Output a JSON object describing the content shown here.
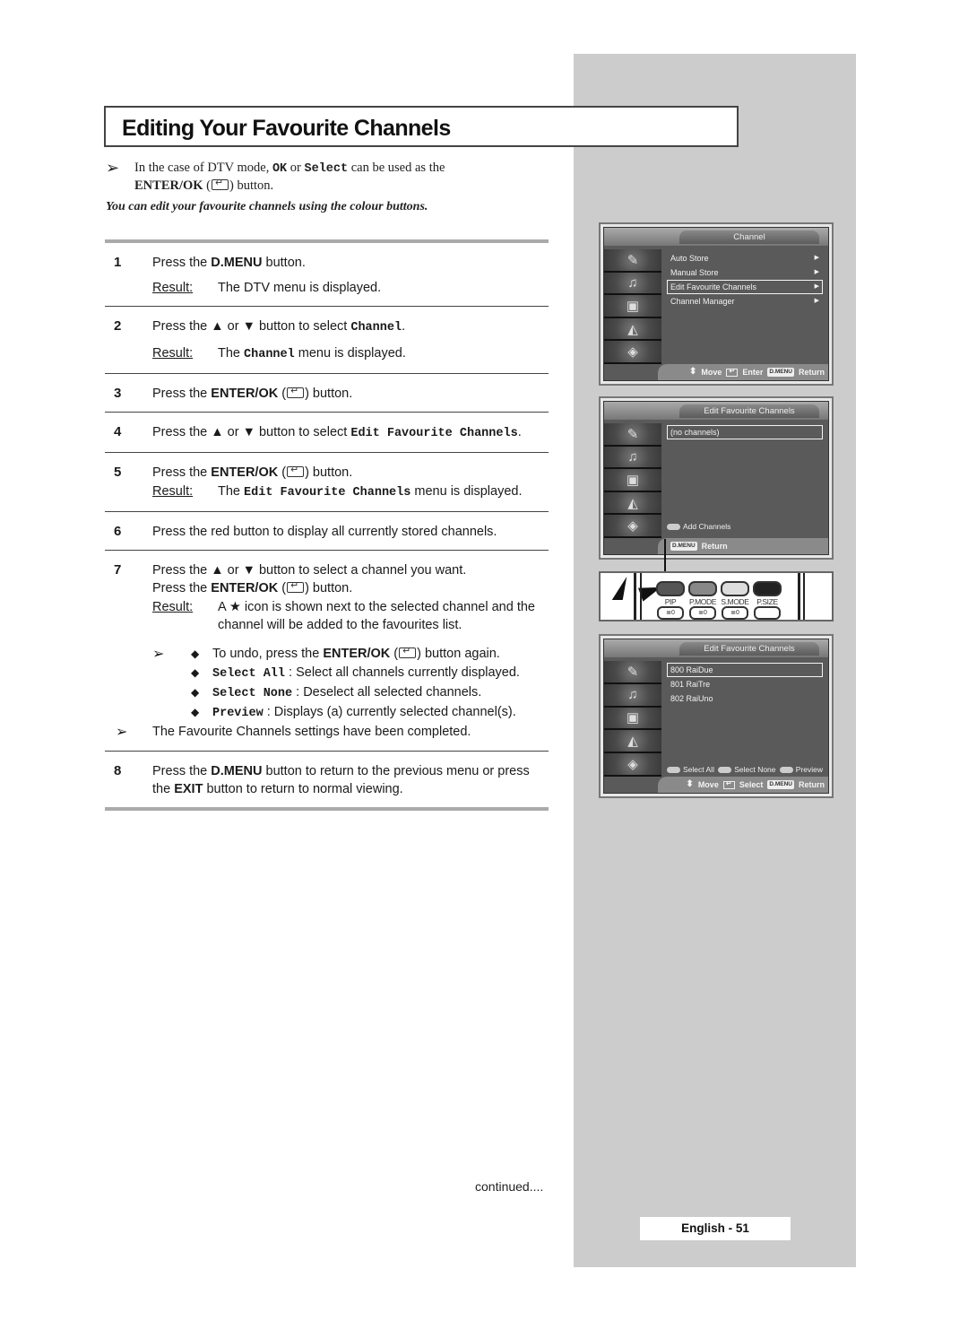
{
  "page": {
    "title": "Editing Your Favourite Channels",
    "note_top": {
      "prefix": "In the case of DTV mode,",
      "ok": "OK",
      "or": "or",
      "select": "Select",
      "suffix": "can be used as the",
      "enter_ok": "ENTER/OK",
      "button_word": "button."
    },
    "intro": "You can edit your favourite channels using the colour buttons.",
    "result_label": "Result:",
    "steps": [
      {
        "num": "1",
        "pre": "Press the",
        "bold": "D.MENU",
        "post": "button.",
        "result": "The DTV menu is displayed."
      },
      {
        "num": "2",
        "pre": "Press the ▲ or ▼ button to select",
        "mono": "Channel",
        "post": ".",
        "result_pre": "The",
        "result_mono": "Channel",
        "result_post": "menu is displayed."
      },
      {
        "num": "3",
        "pre": "Press the",
        "bold": "ENTER/OK",
        "post": "button."
      },
      {
        "num": "4",
        "pre": "Press the ▲ or ▼ button to select",
        "mono": "Edit Favourite Channels",
        "post": "."
      },
      {
        "num": "5",
        "pre": "Press the",
        "bold": "ENTER/OK",
        "post": "button.",
        "result_pre": "The",
        "result_mono": "Edit Favourite Channels",
        "result_post": "menu is displayed."
      },
      {
        "num": "6",
        "text": "Press the red button to display all currently stored channels."
      },
      {
        "num": "7",
        "line1": "Press the ▲ or ▼ button to select a channel you want.",
        "pre": "Press the",
        "bold": "ENTER/OK",
        "post": "button.",
        "result": "A ★ icon is shown next to the selected channel and the channel will be added to the favourites list."
      },
      {
        "num": "8",
        "pre": "Press the",
        "bold": "D.MENU",
        "mid": "button to return to the previous menu or press the",
        "bold2": "EXIT",
        "post": "button to return to normal viewing."
      }
    ],
    "tips": {
      "undo_pre": "To undo, press the",
      "undo_bold": "ENTER/OK",
      "undo_post": "button again.",
      "select_all_key": "Select All",
      "select_all_desc": ": Select all channels currently displayed.",
      "select_none_key": "Select None",
      "select_none_desc": ": Deselect all selected channels.",
      "preview_key": "Preview",
      "preview_desc": ": Displays (a) currently selected channel(s).",
      "completed": "The Favourite Channels settings have been completed."
    },
    "continued": "continued....",
    "page_number": "English - 51"
  },
  "osd1": {
    "title": "Channel",
    "items": [
      {
        "label": "Auto Store",
        "arrow": "▶",
        "selected": false
      },
      {
        "label": "Manual Store",
        "arrow": "▶",
        "selected": false
      },
      {
        "label": "Edit Favourite Channels",
        "arrow": "▶",
        "selected": true
      },
      {
        "label": "Channel Manager",
        "arrow": "▶",
        "selected": false
      }
    ],
    "footer": {
      "move": "Move",
      "enter": "Enter",
      "dmenu": "D.MENU",
      "return": "Return"
    }
  },
  "osd2": {
    "title": "Edit Favourite Channels",
    "items": [
      {
        "label": "(no channels)",
        "selected": true
      }
    ],
    "action": "Add Channels",
    "footer": {
      "dmenu": "D.MENU",
      "return": "Return"
    }
  },
  "remote": {
    "buttons": [
      {
        "label": "PIP",
        "color": "#555555"
      },
      {
        "label": "P.MODE",
        "color": "#888888"
      },
      {
        "label": "S.MODE",
        "color": "#dddddd"
      },
      {
        "label": "P.SIZE",
        "color": "#222222"
      }
    ],
    "sub_icon": "≣0"
  },
  "osd3": {
    "title": "Edit Favourite Channels",
    "items": [
      {
        "label": "800 RaiDue",
        "selected": true
      },
      {
        "label": "801 RaiTre",
        "selected": false
      },
      {
        "label": "802 RaiUno",
        "selected": false
      }
    ],
    "actions": [
      "Select All",
      "Select None",
      "Preview"
    ],
    "footer": {
      "move": "Move",
      "select": "Select",
      "dmenu": "D.MENU",
      "return": "Return"
    }
  },
  "glyphs": {
    "arrow": "➢",
    "bullet": "◆",
    "updown": "⬍"
  }
}
